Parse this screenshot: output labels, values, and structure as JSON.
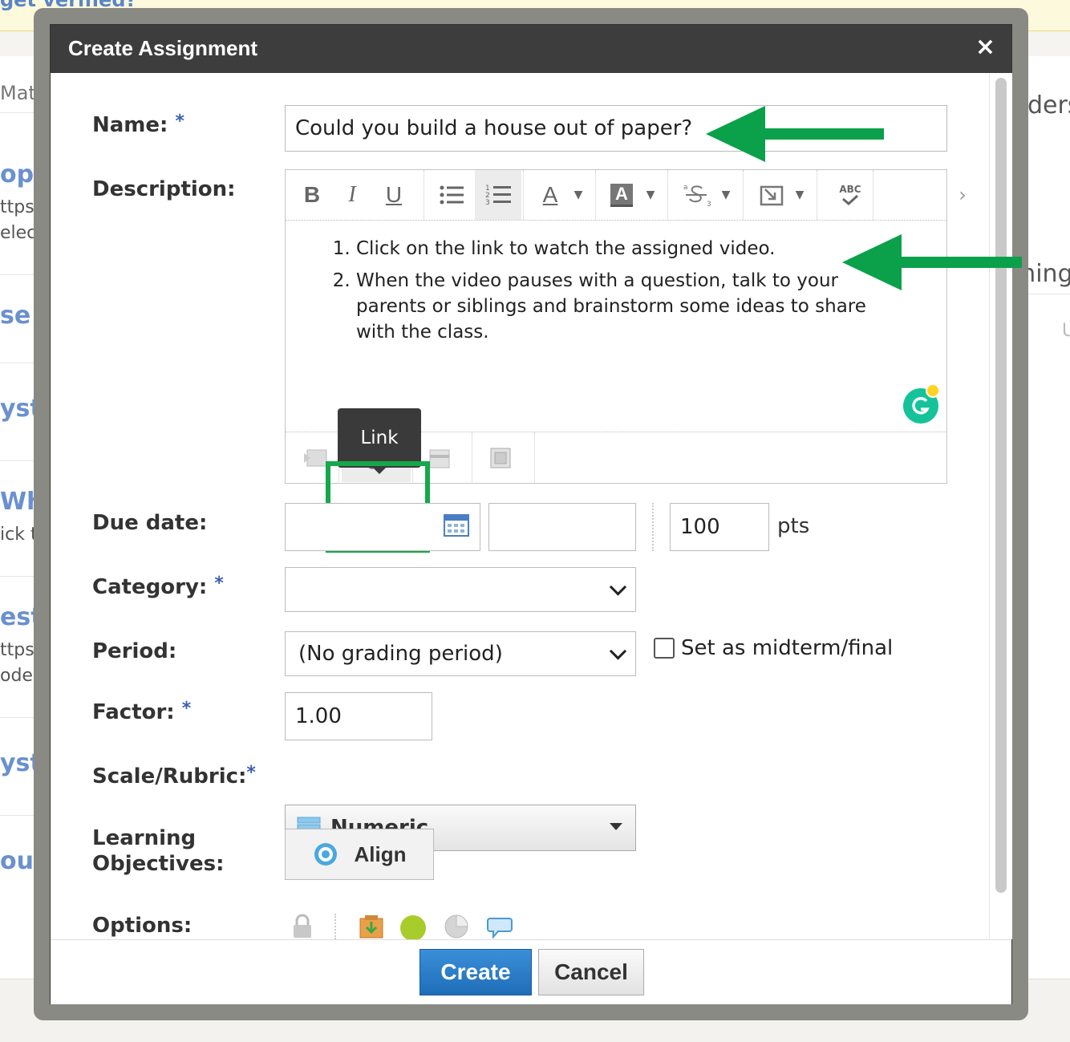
{
  "background": {
    "banner_text": "get verified?",
    "left_items": [
      {
        "title": "Mater"
      },
      {
        "title": "opy a",
        "line1": "ttps://",
        "line2": "electio"
      },
      {
        "title": "se lin"
      },
      {
        "title": "yste"
      },
      {
        "title": "Where",
        "line1": "ick th"
      },
      {
        "title": "est as",
        "line1": "ttps://",
        "line2": "ode=N"
      },
      {
        "title": "yste"
      },
      {
        "title": "ould"
      }
    ],
    "right_items": [
      "nders",
      "ming",
      "U"
    ]
  },
  "dialog": {
    "title": "Create Assignment",
    "close_label": "×"
  },
  "form": {
    "name": {
      "label": "Name:",
      "required_mark": "*",
      "value": "Could you build a house out of paper?"
    },
    "description": {
      "label": "Description:",
      "items": [
        "Click on the link to watch the assigned video.",
        "When the video pauses with a question, talk to your parents or siblings and brainstorm some ideas to share with the class."
      ],
      "toolbar": {
        "bold": "B",
        "italic": "I",
        "underline": "U",
        "font_color": "A",
        "bg_color": "A",
        "spellcheck": "ABC"
      },
      "tooltip": "Link"
    },
    "due_date": {
      "label": "Due date:",
      "date_value": "",
      "time_value": "",
      "points": "100",
      "points_unit": "pts"
    },
    "category": {
      "label": "Category:",
      "required_mark": "*",
      "value": ""
    },
    "period": {
      "label": "Period:",
      "value": "(No grading period)",
      "midterm_label": "Set as midterm/final",
      "midterm_checked": false
    },
    "factor": {
      "label": "Factor:",
      "required_mark": "*",
      "value": "1.00"
    },
    "scale": {
      "label": "Scale/Rubric:",
      "required_mark": "*",
      "value": "Numeric"
    },
    "learning_objectives": {
      "label_line1": "Learning",
      "label_line2": "Objectives:",
      "align_label": "Align"
    },
    "options": {
      "label": "Options:"
    }
  },
  "footer": {
    "create_label": "Create",
    "cancel_label": "Cancel"
  },
  "colors": {
    "arrow_green": "#0aa14a",
    "highlight_green": "#14a84b",
    "create_blue": "#2a7bc8",
    "required_blue": "#3c5fb4"
  }
}
